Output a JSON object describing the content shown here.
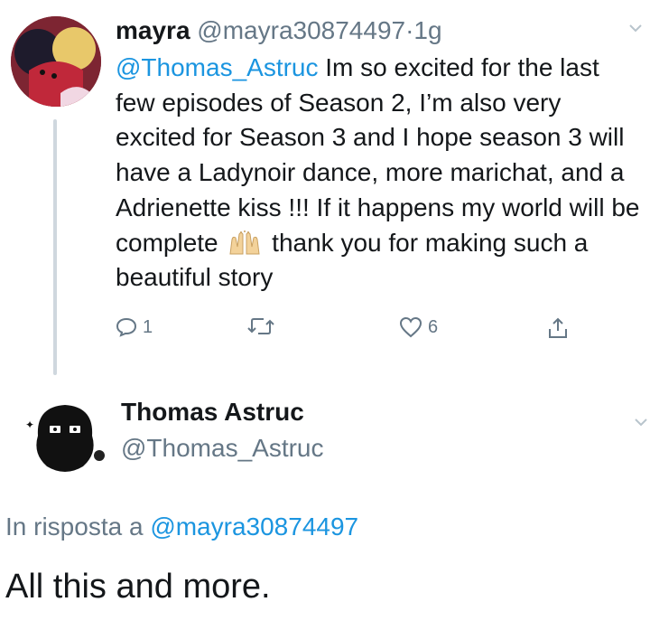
{
  "tweet": {
    "author_name": "mayra",
    "author_handle": "@mayra30874497",
    "separator": "·",
    "time": "1g",
    "mention": "@Thomas_Astruc",
    "text_part1": " Im so excited for the last few episodes of Season 2, I’m also very excited for Season 3 and I hope season 3 will have a Ladynoir dance, more marichat, and a Adrienette kiss !!! If it happens my world will be complete ",
    "emoji": "raising-hands-emoji",
    "text_part2": " thank you for making such a beautiful story",
    "actions": {
      "reply_count": "1",
      "retweet_count": "",
      "like_count": "6"
    }
  },
  "reply": {
    "author_name": "Thomas Astruc",
    "author_handle": "@Thomas_Astruc",
    "in_reply_prefix": "In risposta a ",
    "in_reply_handle": "@mayra30874497",
    "text": "All this and more."
  },
  "colors": {
    "link": "#1b95e0",
    "secondary": "#657786",
    "thread_line": "#cfd7de"
  }
}
